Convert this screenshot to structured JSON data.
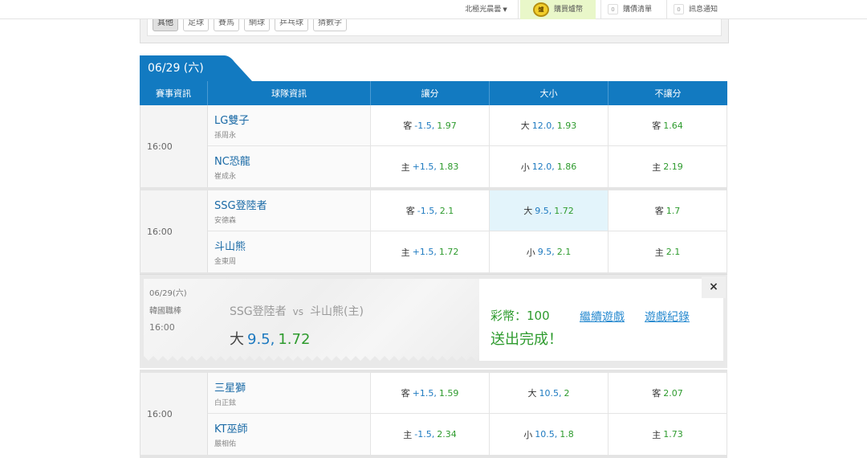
{
  "topbar": {
    "user": "北極光晨曇",
    "shop": "購買爐幣",
    "coin_label": "爐",
    "list_count": "0",
    "list": "購債清單",
    "msg_count": "0",
    "msg": "訊息通知"
  },
  "filters": [
    "其他",
    "足球",
    "賽馬",
    "網球",
    "乒乓球",
    "猜數字"
  ],
  "date_tab": "06/29 (六)",
  "table_headers": [
    "賽事資訊",
    "球隊資訊",
    "讓分",
    "大小",
    "不讓分"
  ],
  "games": [
    {
      "time": "16:00",
      "rows": [
        {
          "team": "LG雙子",
          "pitcher": "孫周永",
          "spread": {
            "side": "客",
            "line": "-1.5,",
            "odds": "1.97"
          },
          "total": {
            "side": "大",
            "line": "12.0,",
            "odds": "1.93"
          },
          "ml": {
            "side": "客",
            "odds": "1.64"
          }
        },
        {
          "team": "NC恐龍",
          "pitcher": "崔成永",
          "spread": {
            "side": "主",
            "line": "+1.5,",
            "odds": "1.83"
          },
          "total": {
            "side": "小",
            "line": "12.0,",
            "odds": "1.86"
          },
          "ml": {
            "side": "主",
            "odds": "2.19"
          }
        }
      ]
    },
    {
      "time": "16:00",
      "rows": [
        {
          "team": "SSG登陸者",
          "pitcher": "安德森",
          "spread": {
            "side": "客",
            "line": "-1.5,",
            "odds": "2.1"
          },
          "total": {
            "side": "大",
            "line": "9.5,",
            "odds": "1.72"
          },
          "ml": {
            "side": "客",
            "odds": "1.7"
          }
        },
        {
          "team": "斗山熊",
          "pitcher": "金東周",
          "spread": {
            "side": "主",
            "line": "+1.5,",
            "odds": "1.72"
          },
          "total": {
            "side": "小",
            "line": "9.5,",
            "odds": "2.1"
          },
          "ml": {
            "side": "主",
            "odds": "2.1"
          }
        }
      ]
    },
    {
      "time": "16:00",
      "rows": [
        {
          "team": "三星獅",
          "pitcher": "白正鉉",
          "spread": {
            "side": "客",
            "line": "+1.5,",
            "odds": "1.59"
          },
          "total": {
            "side": "大",
            "line": "10.5,",
            "odds": "2"
          },
          "ml": {
            "side": "客",
            "odds": "2.07"
          }
        },
        {
          "team": "KT巫師",
          "pitcher": "嚴相佑",
          "spread": {
            "side": "主",
            "line": "-1.5,",
            "odds": "2.34"
          },
          "total": {
            "side": "小",
            "line": "10.5,",
            "odds": "1.8"
          },
          "ml": {
            "side": "主",
            "odds": "1.73"
          }
        }
      ]
    }
  ],
  "slip": {
    "date": "06/29(六)",
    "league": "韓國職棒",
    "time": "16:00",
    "away": "SSG登陸者",
    "vs": "vs",
    "home": "斗山熊(主)",
    "pick_side": "大",
    "pick_line": "9.5,",
    "pick_odds": "1.72",
    "stake": "彩幣：100",
    "success": "送出完成！",
    "continue": "繼續遊戲",
    "history": "遊戲紀錄",
    "close": "×"
  }
}
